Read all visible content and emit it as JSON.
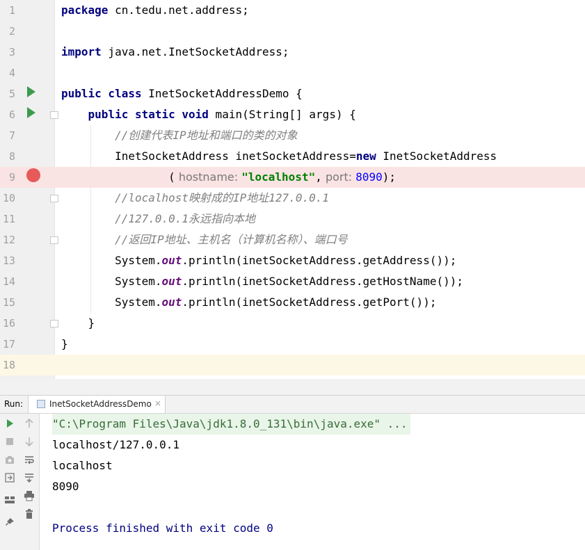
{
  "editor": {
    "lines": [
      {
        "num": "1",
        "tokens": [
          {
            "t": "package",
            "c": "kw"
          },
          {
            "t": " cn.tedu.net.address;",
            "c": ""
          }
        ]
      },
      {
        "num": "2",
        "tokens": []
      },
      {
        "num": "3",
        "tokens": [
          {
            "t": "import",
            "c": "kw"
          },
          {
            "t": " java.net.InetSocketAddress;",
            "c": ""
          }
        ]
      },
      {
        "num": "4",
        "tokens": []
      },
      {
        "num": "5",
        "tokens": [
          {
            "t": "public class",
            "c": "kw"
          },
          {
            "t": " InetSocketAddressDemo {",
            "c": ""
          }
        ]
      },
      {
        "num": "6",
        "tokens": [
          {
            "t": "    ",
            "c": ""
          },
          {
            "t": "public static void",
            "c": "kw"
          },
          {
            "t": " main(String[] args) {",
            "c": ""
          }
        ]
      },
      {
        "num": "7",
        "tokens": [
          {
            "t": "        ",
            "c": ""
          },
          {
            "t": "//创建代表IP地址和端口的类的对象",
            "c": "cmt"
          }
        ]
      },
      {
        "num": "8",
        "tokens": [
          {
            "t": "        InetSocketAddress inetSocketAddress=",
            "c": ""
          },
          {
            "t": "new",
            "c": "kw"
          },
          {
            "t": " InetSocketAddress",
            "c": ""
          }
        ]
      },
      {
        "num": "9",
        "tokens": [
          {
            "t": "                (",
            "c": ""
          },
          {
            "t": " hostname: ",
            "c": "hint"
          },
          {
            "t": "\"localhost\"",
            "c": "str"
          },
          {
            "t": ",",
            "c": ""
          },
          {
            "t": " port: ",
            "c": "hint"
          },
          {
            "t": "8090",
            "c": "num"
          },
          {
            "t": ");",
            "c": ""
          }
        ]
      },
      {
        "num": "10",
        "tokens": [
          {
            "t": "        ",
            "c": ""
          },
          {
            "t": "//localhost映射成的IP地址127.0.0.1",
            "c": "cmt"
          }
        ]
      },
      {
        "num": "11",
        "tokens": [
          {
            "t": "        ",
            "c": ""
          },
          {
            "t": "//127.0.0.1永远指向本地",
            "c": "cmt"
          }
        ]
      },
      {
        "num": "12",
        "tokens": [
          {
            "t": "        ",
            "c": ""
          },
          {
            "t": "//返回IP地址、主机名（计算机名称）、端口号",
            "c": "cmt"
          }
        ]
      },
      {
        "num": "13",
        "tokens": [
          {
            "t": "        System.",
            "c": ""
          },
          {
            "t": "out",
            "c": "fld"
          },
          {
            "t": ".println(inetSocketAddress.getAddress());",
            "c": ""
          }
        ]
      },
      {
        "num": "14",
        "tokens": [
          {
            "t": "        System.",
            "c": ""
          },
          {
            "t": "out",
            "c": "fld"
          },
          {
            "t": ".println(inetSocketAddress.getHostName());",
            "c": ""
          }
        ]
      },
      {
        "num": "15",
        "tokens": [
          {
            "t": "        System.",
            "c": ""
          },
          {
            "t": "out",
            "c": "fld"
          },
          {
            "t": ".println(inetSocketAddress.getPort());",
            "c": ""
          }
        ]
      },
      {
        "num": "16",
        "tokens": [
          {
            "t": "    }",
            "c": ""
          }
        ]
      },
      {
        "num": "17",
        "tokens": [
          {
            "t": "}",
            "c": ""
          }
        ]
      },
      {
        "num": "18",
        "tokens": []
      }
    ]
  },
  "run_panel": {
    "label": "Run:",
    "tab_title": "InetSocketAddressDemo",
    "tab_close": "×",
    "console_lines": [
      "\"C:\\Program Files\\Java\\jdk1.8.0_131\\bin\\java.exe\" ...",
      "localhost/127.0.0.1",
      "localhost",
      "8090",
      "",
      "Process finished with exit code 0"
    ]
  },
  "icons": {
    "run_gutter": "run-arrow-icon",
    "breakpoint": "breakpoint-icon",
    "fold": "fold-marker-icon",
    "toolbar": [
      "rerun-icon",
      "stop-icon",
      "camera-icon",
      "restore-layout-icon",
      "layout-icon",
      "pin-icon",
      "scroll-up-icon",
      "scroll-down-icon",
      "soft-wrap-icon",
      "scroll-to-end-icon",
      "print-icon",
      "trash-icon"
    ]
  },
  "colors": {
    "keyword": "#000080",
    "comment": "#808080",
    "string": "#008000",
    "number": "#0000ff",
    "field": "#660e7a",
    "run_arrow": "#3d9b4e",
    "breakpoint": "#e65a5a"
  }
}
